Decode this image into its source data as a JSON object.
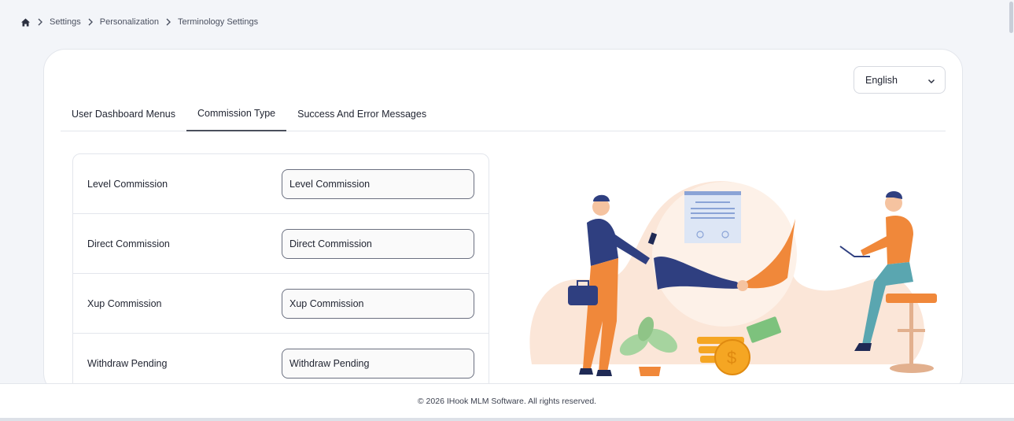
{
  "breadcrumb": {
    "home_icon": "home-icon",
    "items": [
      "Settings",
      "Personalization",
      "Terminology Settings"
    ]
  },
  "language_select": {
    "value": "English"
  },
  "tabs": [
    {
      "label": "User Dashboard Menus",
      "active": false
    },
    {
      "label": "Commission Type",
      "active": true
    },
    {
      "label": "Success And Error Messages",
      "active": false
    }
  ],
  "terms": [
    {
      "label": "Level Commission",
      "value": "Level Commission"
    },
    {
      "label": "Direct Commission",
      "value": "Direct Commission"
    },
    {
      "label": "Xup Commission",
      "value": "Xup Commission"
    },
    {
      "label": "Withdraw Pending",
      "value": "Withdraw Pending"
    }
  ],
  "footer": {
    "text": "© 2026 IHook MLM Software. All rights reserved."
  },
  "colors": {
    "accent_orange": "#f0883a",
    "navy": "#2f3f80",
    "teal": "#5aa6b0",
    "blob": "#fbe6d8"
  }
}
